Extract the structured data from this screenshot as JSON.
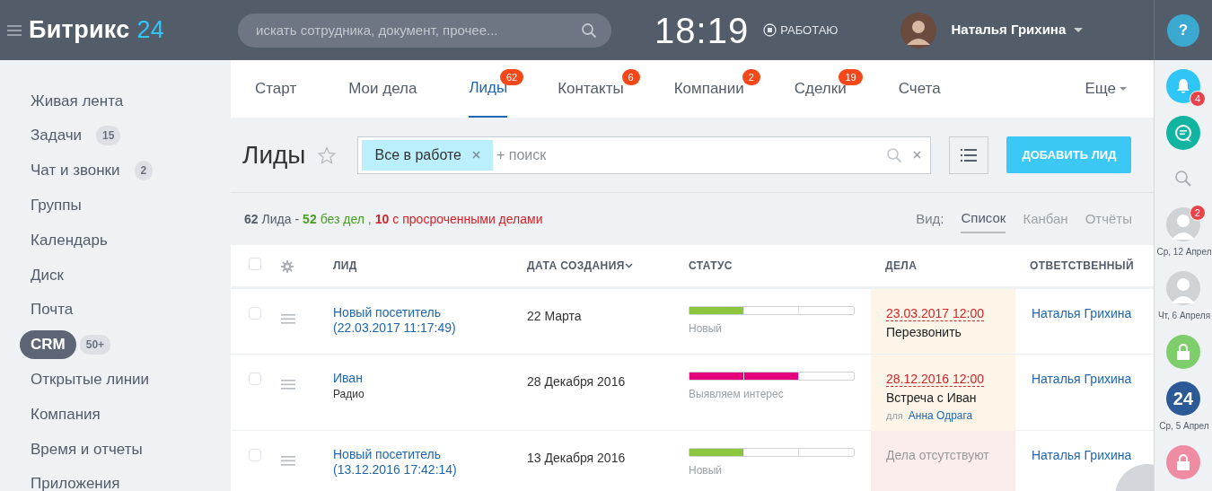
{
  "header": {
    "logo": {
      "name": "Битрикс",
      "suffix": "24"
    },
    "search": {
      "placeholder": "искать сотрудника, документ, прочее..."
    },
    "time": "18:19",
    "work_status": "РАБОТАЮ",
    "user": "Наталья Грихина",
    "help": "?"
  },
  "sidebar": {
    "items": [
      {
        "label": "Живая лента",
        "selected": false
      },
      {
        "label": "Задачи",
        "counter": "15",
        "selected": false
      },
      {
        "label": "Чат и звонки",
        "counter": "2",
        "selected": false
      },
      {
        "label": "Группы",
        "selected": false
      },
      {
        "label": "Календарь",
        "selected": false
      },
      {
        "label": "Диск",
        "selected": false
      },
      {
        "label": "Почта",
        "selected": false
      },
      {
        "label": "CRM",
        "counter": "50+",
        "selected": true
      },
      {
        "label": "Открытые линии",
        "selected": false
      },
      {
        "label": "Компания",
        "selected": false
      },
      {
        "label": "Время и отчеты",
        "selected": false
      },
      {
        "label": "Приложения",
        "selected": false
      }
    ]
  },
  "tabs": [
    {
      "label": "Старт",
      "selected": false
    },
    {
      "label": "Мои дела",
      "selected": false
    },
    {
      "label": "Лиды",
      "badge": "62",
      "selected": true
    },
    {
      "label": "Контакты",
      "badge": "6",
      "selected": false
    },
    {
      "label": "Компании",
      "badge": "2",
      "selected": false
    },
    {
      "label": "Сделки",
      "badge": "19",
      "selected": false
    },
    {
      "label": "Счета",
      "selected": false
    }
  ],
  "more_tab": "Еще",
  "page": {
    "title": "Лиды",
    "filter": {
      "chip": "Все в работе",
      "placeholder": "+ поиск"
    },
    "add_button": "ДОБАВИТЬ ЛИД"
  },
  "summary": [
    {
      "kind": "total",
      "count": "62",
      "text": "Лида -"
    },
    {
      "kind": "ok",
      "count": "52",
      "text": "без дел ,"
    },
    {
      "kind": "overdue",
      "count": "10",
      "text": "с просроченными делами"
    }
  ],
  "view": {
    "label": "Вид:",
    "options": [
      {
        "label": "Список",
        "selected": true
      },
      {
        "label": "Канбан",
        "selected": false
      },
      {
        "label": "Отчёты",
        "selected": false
      }
    ]
  },
  "table": {
    "select_all": {
      "checked": false
    },
    "columns": [
      {
        "label": "ЛИД",
        "sorted": false
      },
      {
        "label": "ДАТА СОЗДАНИЯ",
        "sorted": true
      },
      {
        "label": "СТАТУС",
        "sorted": false
      },
      {
        "label": "ДЕЛА",
        "sorted": false
      },
      {
        "label": "ОТВЕТСТВЕННЫЙ",
        "sorted": false
      }
    ],
    "rows": [
      {
        "checked": false,
        "lead": "Новый посетитель (22.03.2017 11:17:49)",
        "date": "22 Марта",
        "status": {
          "label": "Новый",
          "level": 0.33,
          "color": "#8cc63f"
        },
        "deal": {
          "kind": "task",
          "date": "23.03.2017 12:00",
          "title": "Перезвонить"
        },
        "responsible": "Наталья Грихина"
      },
      {
        "checked": false,
        "lead": "Иван",
        "source": "Радио",
        "date": "28 Декабря 2016",
        "status": {
          "label": "Выявляем интерес",
          "level": 0.66,
          "color": "#e4007d"
        },
        "deal": {
          "kind": "task",
          "date": "28.12.2016 12:00",
          "title": "Встреча с Иван",
          "for_label": "для",
          "for_name": "Анна Одрага"
        },
        "responsible": "Наталья Грихина"
      },
      {
        "checked": false,
        "lead": "Новый посетитель (13.12.2016 17:42:14)",
        "date": "13 Декабря 2016",
        "status": {
          "label": "Новый",
          "level": 0.33,
          "color": "#8cc63f"
        },
        "deal": {
          "kind": "none",
          "title": "Дела отсутствуют"
        },
        "responsible": "Наталья Грихина"
      }
    ]
  },
  "right_bar": [
    {
      "kind": "bell",
      "color": "#2fc6f6",
      "badge": "4"
    },
    {
      "kind": "chat",
      "color": "#10b4a0"
    },
    {
      "kind": "search"
    },
    {
      "kind": "avatar",
      "badge": "2",
      "caption": "Ср, 12 Апрел"
    },
    {
      "kind": "avatar",
      "caption": "Чт, 6 Апреля"
    },
    {
      "kind": "lock",
      "color": "#7fce6c"
    },
    {
      "kind": "logo",
      "color": "#2c5a96",
      "text": "24",
      "caption": "Ср, 5 Апрел"
    },
    {
      "kind": "lock",
      "color": "#ef8ba3"
    }
  ]
}
